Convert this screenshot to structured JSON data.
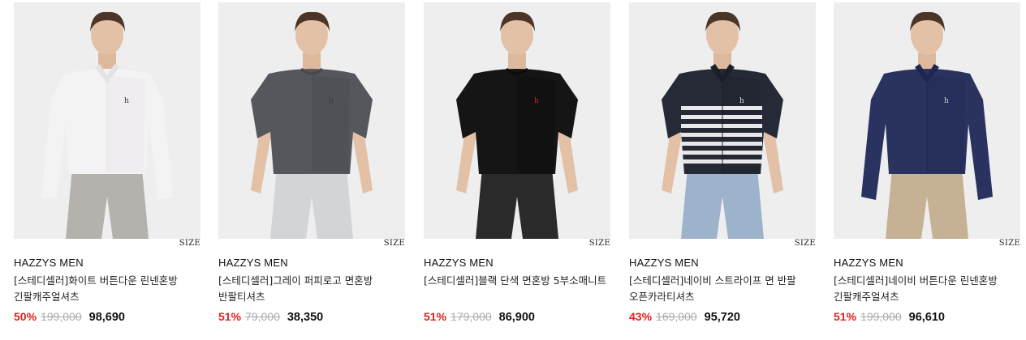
{
  "products": [
    {
      "brand": "HAZZYS MEN",
      "name": "[스테디셀러]화이트 버튼다운 린넨혼방 긴팔캐주얼셔츠",
      "size_label": "SIZE",
      "discount": "50%",
      "original_price": "199,000",
      "sale_price": "98,690",
      "image": {
        "top_color": "#f4f3f4",
        "top_shade": "#e4e2e4",
        "bottom_color": "#b5b2ae",
        "logo_color": "#333333",
        "type": "shirt-long"
      }
    },
    {
      "brand": "HAZZYS MEN",
      "name": "[스테디셀러]그레이 퍼피로고 면혼방 반팔티셔츠",
      "size_label": "SIZE",
      "discount": "51%",
      "original_price": "79,000",
      "sale_price": "38,350",
      "image": {
        "top_color": "#55575c",
        "top_shade": "#46484c",
        "bottom_color": "#d2d4d8",
        "logo_color": "#3a3c40",
        "type": "tee"
      }
    },
    {
      "brand": "HAZZYS MEN",
      "name": "[스테디셀러]블랙 단색 면혼방 5부소매니트",
      "size_label": "SIZE",
      "discount": "51%",
      "original_price": "179,000",
      "sale_price": "86,900",
      "image": {
        "top_color": "#151515",
        "top_shade": "#0b0b0b",
        "bottom_color": "#2a2a2a",
        "logo_color": "#c8262a",
        "type": "knit"
      }
    },
    {
      "brand": "HAZZYS MEN",
      "name": "[스테디셀러]네이비 스트라이프 면 반팔 오픈카라티셔츠",
      "size_label": "SIZE",
      "discount": "43%",
      "original_price": "169,000",
      "sale_price": "95,720",
      "image": {
        "top_color": "#262a36",
        "top_shade": "#1c1f28",
        "bottom_color": "#9db3cc",
        "logo_color": "#dddddd",
        "type": "polo-stripe"
      }
    },
    {
      "brand": "HAZZYS MEN",
      "name": "[스테디셀러]네이비 버튼다운 린넨혼방 긴팔캐주얼셔츠",
      "size_label": "SIZE",
      "discount": "51%",
      "original_price": "199,000",
      "sale_price": "96,610",
      "image": {
        "top_color": "#2a3360",
        "top_shade": "#1f2650",
        "bottom_color": "#c7b195",
        "logo_color": "#d0d0d8",
        "type": "shirt-long"
      }
    }
  ]
}
